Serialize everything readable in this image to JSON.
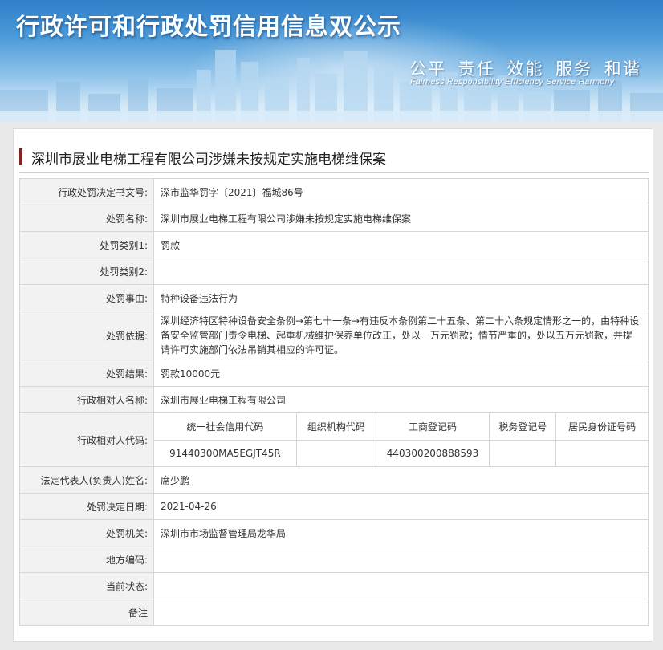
{
  "banner": {
    "title": "行政许可和行政处罚信用信息双公示",
    "slogan_cn": "公平 责任 效能 服务 和谐",
    "slogan_en": "Fairness Responsibility Efficiency Service Harmony"
  },
  "case_title": "深圳市展业电梯工程有限公司涉嫌未按规定实施电梯维保案",
  "fields": {
    "decision_no": {
      "label": "行政处罚决定书文号:",
      "value": "深市监华罚字〔2021〕福城86号"
    },
    "penalty_name": {
      "label": "处罚名称:",
      "value": "深圳市展业电梯工程有限公司涉嫌未按规定实施电梯维保案"
    },
    "category1": {
      "label": "处罚类别1:",
      "value": "罚款"
    },
    "category2": {
      "label": "处罚类别2:",
      "value": ""
    },
    "cause": {
      "label": "处罚事由:",
      "value": "特种设备违法行为"
    },
    "basis": {
      "label": "处罚依据:",
      "value": "深圳经济特区特种设备安全条例→第七十一条→有违反本条例第二十五条、第二十六条规定情形之一的，由特种设备安全监管部门责令电梯、起重机械维护保养单位改正，处以一万元罚款；情节严重的，处以五万元罚款，并提请许可实施部门依法吊销其相应的许可证。"
    },
    "result": {
      "label": "处罚结果:",
      "value": "罚款10000元"
    },
    "party_name": {
      "label": "行政相对人名称:",
      "value": "深圳市展业电梯工程有限公司"
    },
    "party_codes": {
      "label": "行政相对人代码:",
      "headers": [
        "统一社会信用代码",
        "组织机构代码",
        "工商登记码",
        "税务登记号",
        "居民身份证号码"
      ],
      "values": [
        "91440300MA5EGJT45R",
        "",
        "440300200888593",
        "",
        ""
      ]
    },
    "legal_rep": {
      "label": "法定代表人(负责人)姓名:",
      "value": "席少鹏"
    },
    "decision_date": {
      "label": "处罚决定日期:",
      "value": "2021-04-26"
    },
    "authority": {
      "label": "处罚机关:",
      "value": "深圳市市场监督管理局龙华局"
    },
    "local_code": {
      "label": "地方编码:",
      "value": ""
    },
    "current_status": {
      "label": "当前状态:",
      "value": ""
    },
    "remark": {
      "label": "备注",
      "value": ""
    }
  }
}
